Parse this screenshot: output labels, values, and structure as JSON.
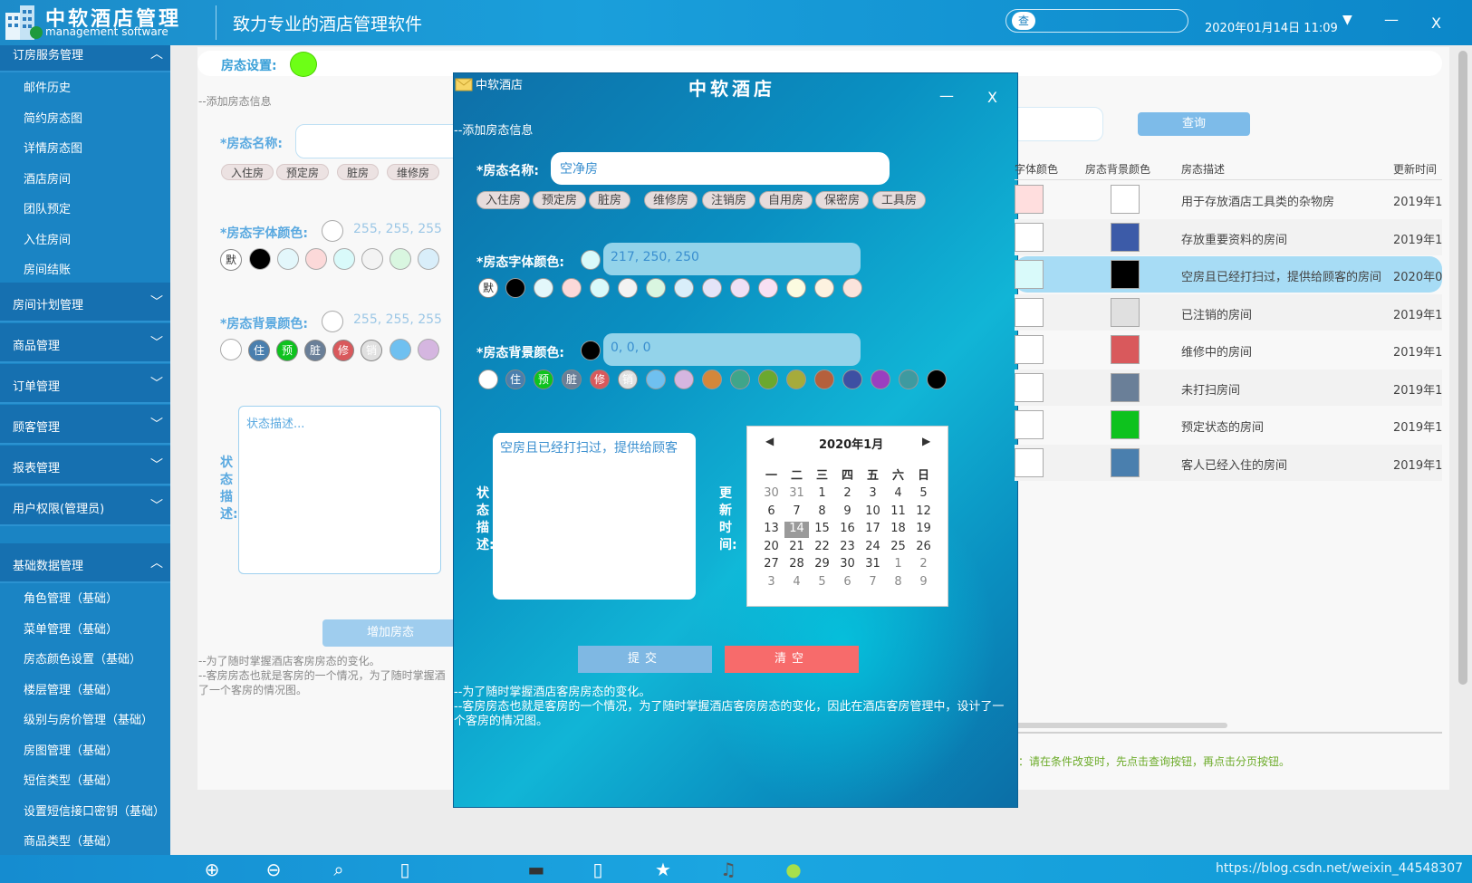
{
  "header": {
    "brand_cn": "中软酒店管理",
    "brand_en": "management software",
    "slogan": "致力专业的酒店管理软件",
    "search_btn": "查",
    "datetime": "2020年01月14日 11:09",
    "menu_arrow": "▼",
    "minimize": "—",
    "close": "X"
  },
  "sidebar": {
    "top_group": "订房服务管理",
    "top_items": [
      "邮件历史",
      "简约房态图",
      "详情房态图",
      "酒店房间",
      "团队预定",
      "入住房间",
      "房间结账"
    ],
    "groups": [
      "房间计划管理",
      "商品管理",
      "订单管理",
      "顾客管理",
      "报表管理",
      "用户权限(管理员)"
    ],
    "base_group": "基础数据管理",
    "base_items": [
      "角色管理（基础）",
      "菜单管理（基础）",
      "房态颜色设置（基础）",
      "楼层管理（基础）",
      "级别与房价管理（基础）",
      "房图管理（基础）",
      "短信类型（基础）",
      "设置短信接口密钥（基础）",
      "商品类型（基础）"
    ]
  },
  "background_form": {
    "status_setting_label": "房态设置:",
    "status_color": "#6dff16",
    "section_note": "--添加房态信息",
    "name_label": "*房态名称:",
    "tags": [
      "入住房",
      "预定房",
      "脏房",
      "维修房"
    ],
    "font_color_label": "*房态字体颜色:",
    "font_color_value": "255, 255, 255",
    "bg_color_label": "*房态背景颜色:",
    "bg_color_value": "255, 255, 255",
    "default_chip": "默",
    "desc_label": "状态描述:",
    "desc_placeholder": "状态描述...",
    "add_button": "增加房态",
    "footnote_1": "--为了随时掌握酒店客房房态的变化。",
    "footnote_2": "--客房房态也就是客房的一个情况，为了随时掌握酒",
    "footnote_3": "了一个客房的情况图。"
  },
  "right_panel": {
    "query_button": "查询",
    "columns": [
      "字体颜色",
      "房态背景颜色",
      "房态描述",
      "更新时间"
    ],
    "rows": [
      {
        "font_color": "#ffdede",
        "bg_color": "#ffffff",
        "desc": "用于存放酒店工具类的杂物房",
        "time": "2019年1"
      },
      {
        "font_color": "#ffffff",
        "bg_color": "#3c5ba8",
        "desc": "存放重要资料的房间",
        "time": "2019年1"
      },
      {
        "font_color": "#d9fafa",
        "bg_color": "#000000",
        "desc": "空房且已经打扫过，提供给顾客的房间",
        "time": "2020年0"
      },
      {
        "font_color": "#ffffff",
        "bg_color": "#e0e0e0",
        "desc": "已注销的房间",
        "time": "2019年1"
      },
      {
        "font_color": "#ffffff",
        "bg_color": "#d9595c",
        "desc": "维修中的房间",
        "time": "2019年1"
      },
      {
        "font_color": "#ffffff",
        "bg_color": "#6a7f98",
        "desc": "未打扫房间",
        "time": "2019年1"
      },
      {
        "font_color": "#ffffff",
        "bg_color": "#0ec21e",
        "desc": "预定状态的房间",
        "time": "2019年1"
      },
      {
        "font_color": "#ffffff",
        "bg_color": "#4a7fae",
        "desc": "客人已经入住的房间",
        "time": "2019年1"
      }
    ],
    "hint": "：请在条件改变时，先点击查询按钮，再点击分页按钮。"
  },
  "dialog": {
    "window_name": "中软酒店",
    "title": "中软酒店",
    "minimize": "—",
    "close": "X",
    "section_note": "--添加房态信息",
    "name_label": "*房态名称:",
    "name_value": "空净房",
    "tags": [
      "入住房",
      "预定房",
      "脏房",
      "维修房",
      "注销房",
      "自用房",
      "保密房",
      "工具房"
    ],
    "font_color_label": "*房态字体颜色:",
    "font_color_value": "217, 250, 250",
    "font_color_swatch": "#d9fafa",
    "font_chips": [
      "#000000",
      "#e3f7fb",
      "#fcd9d9",
      "#d9fafa",
      "#f3f3f3",
      "#d9f6e0",
      "#d9eefa",
      "#e4e4f8",
      "#efe0f5",
      "#f8e0f3",
      "#fbfbe0",
      "#fdf2e0",
      "#fbe4dc"
    ],
    "default_chip": "默",
    "bg_color_label": "*房态背景颜色:",
    "bg_color_value": "0, 0, 0",
    "bg_color_swatch": "#000000",
    "bg_letter_chips": [
      {
        "t": "住",
        "c": "#4a7fae"
      },
      {
        "t": "预",
        "c": "#0ec21e"
      },
      {
        "t": "脏",
        "c": "#6a7f98"
      },
      {
        "t": "修",
        "c": "#d9595c"
      },
      {
        "t": "销",
        "c": "#e0e0e0"
      }
    ],
    "bg_plain_chips": [
      "#6fc0f0",
      "#d5b6e0",
      "#d4873a",
      "#3fa58a",
      "#6ba82f",
      "#a6ab3b",
      "#b5603c",
      "#3d50a3",
      "#9a3fc0",
      "#3e9aa0",
      "#000000"
    ],
    "desc_label": "状态描述:",
    "desc_value": "空房且已经打扫过，提供给顾客",
    "update_label": "更新时间:",
    "calendar_title": "2020年1月",
    "weekdays": [
      "一",
      "二",
      "三",
      "四",
      "五",
      "六",
      "日"
    ],
    "weeks": [
      [
        "30",
        "31",
        "1",
        "2",
        "3",
        "4",
        "5"
      ],
      [
        "6",
        "7",
        "8",
        "9",
        "10",
        "11",
        "12"
      ],
      [
        "13",
        "14",
        "15",
        "16",
        "17",
        "18",
        "19"
      ],
      [
        "20",
        "21",
        "22",
        "23",
        "24",
        "25",
        "26"
      ],
      [
        "27",
        "28",
        "29",
        "30",
        "31",
        "1",
        "2"
      ],
      [
        "3",
        "4",
        "5",
        "6",
        "7",
        "8",
        "9"
      ]
    ],
    "submit": "提交",
    "clear": "清空",
    "footnote_1": "--为了随时掌握酒店客房房态的变化。",
    "footnote_2": "--客房房态也就是客房的一个情况，为了随时掌握酒店客房房态的变化，因此在酒店客房管理中，设计了一",
    "footnote_3": "个客房的情况图。"
  },
  "footer": {
    "watermark": "https://blog.csdn.net/weixin_44548307",
    "icons": [
      "zoom-in-icon",
      "zoom-out-icon",
      "search-icon",
      "phone-icon",
      "gamepad-icon",
      "mobile-icon",
      "star-icon",
      "microphone-icon",
      "globe-icon"
    ]
  }
}
